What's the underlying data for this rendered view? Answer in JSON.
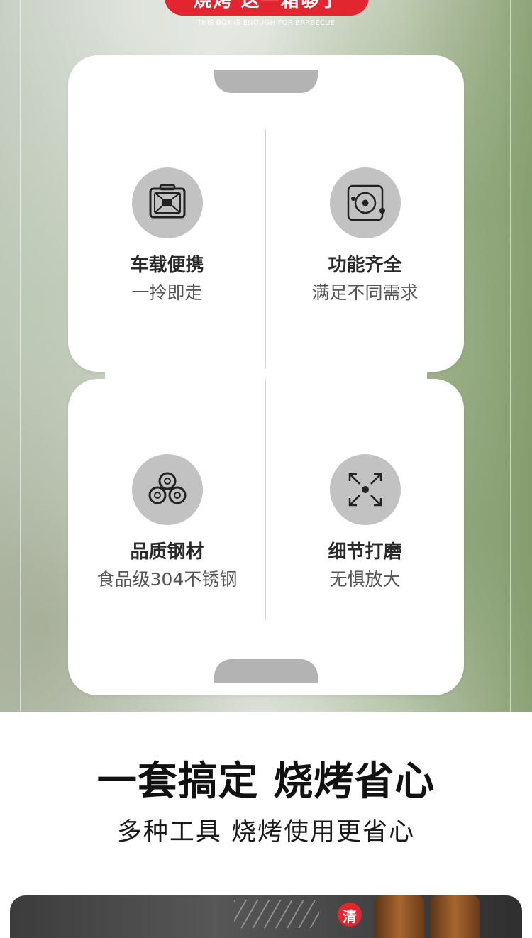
{
  "banner": {
    "title": "烧烤 这一箱够了",
    "subtitle": "THIS BOX IS ENOUGH FOR BARBECUE",
    "accent_color": "#e2252f"
  },
  "features": [
    {
      "icon": "briefcase-icon",
      "title": "车载便携",
      "subtitle": "一拎即走"
    },
    {
      "icon": "target-icon",
      "title": "功能齐全",
      "subtitle": "满足不同需求"
    },
    {
      "icon": "steel-rolls-icon",
      "title": "品质钢材",
      "subtitle": "食品级304不锈钢"
    },
    {
      "icon": "expand-icon",
      "title": "细节打磨",
      "subtitle": "无惧放大"
    }
  ],
  "section": {
    "heading": "一套搞定 烧烤省心",
    "subheading": "多种工具 烧烤使用更省心"
  },
  "bottom_badge": {
    "label": "清"
  }
}
